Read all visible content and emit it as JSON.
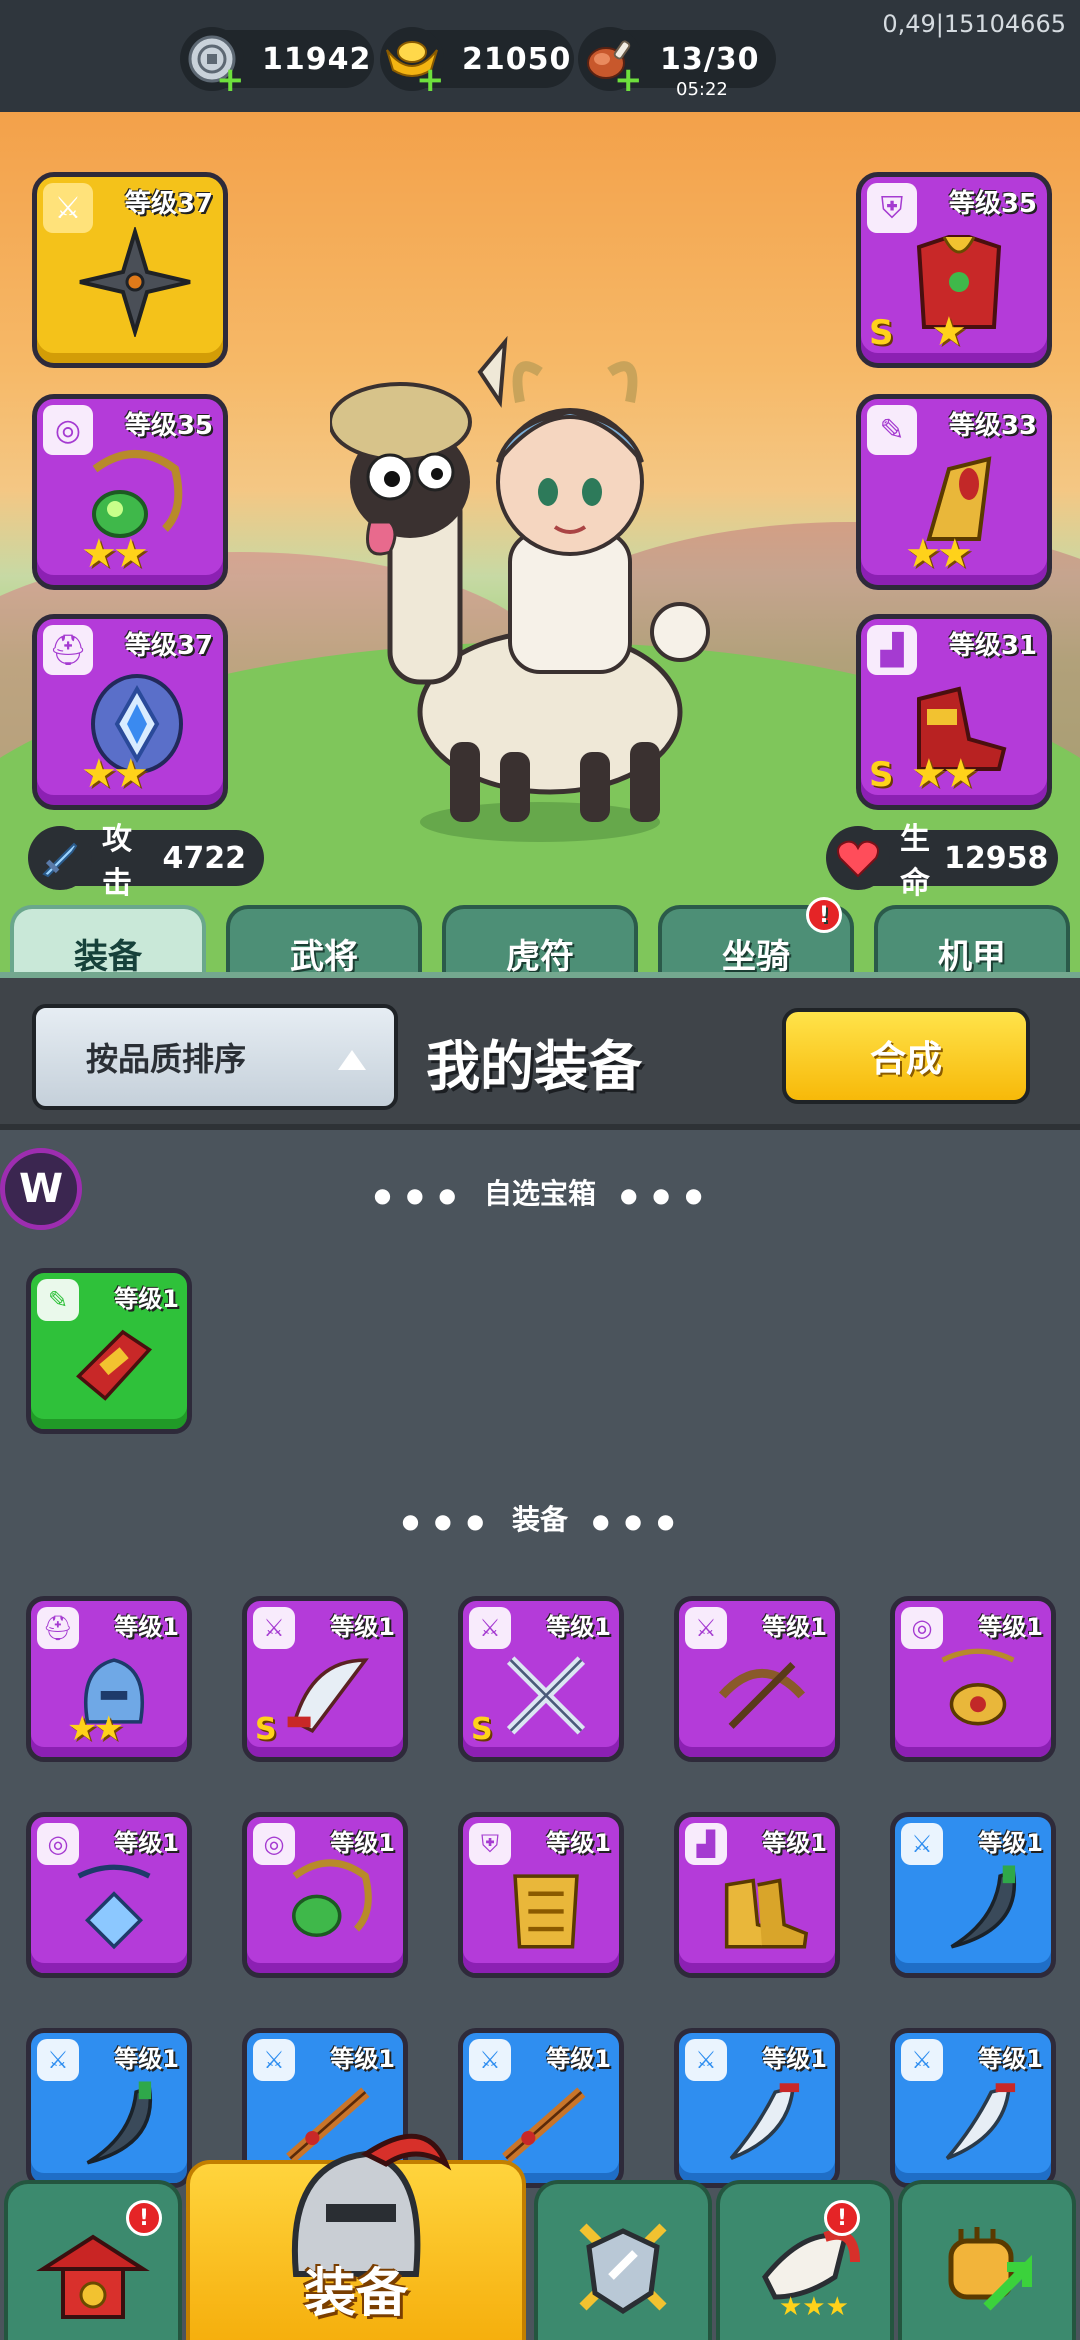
{
  "top_bar": {
    "version": "0,49|15104665",
    "silver": "11942",
    "gold": "21050",
    "stamina": "13/30",
    "stamina_timer": "05:22"
  },
  "hero_slots": [
    {
      "id": "weapon",
      "level": "等级37",
      "rarity": "yellow",
      "type_icon": "sword-icon",
      "item_icon": "shuriken-icon",
      "stars": "",
      "s_rank": ""
    },
    {
      "id": "necklace",
      "level": "等级35",
      "rarity": "purple",
      "type_icon": "medal-icon",
      "item_icon": "jade-necklace-icon",
      "stars": "★★",
      "s_rank": ""
    },
    {
      "id": "helmet",
      "level": "等级37",
      "rarity": "purple",
      "type_icon": "helmet-icon",
      "item_icon": "crest-helmet-icon",
      "stars": "★★",
      "s_rank": ""
    },
    {
      "id": "armor",
      "level": "等级35",
      "rarity": "purple",
      "type_icon": "armor-icon",
      "item_icon": "red-armor-icon",
      "stars": "★",
      "s_rank": "S"
    },
    {
      "id": "bracer",
      "level": "等级33",
      "rarity": "purple",
      "type_icon": "bracer-icon",
      "item_icon": "gold-bracer-icon",
      "stars": "★★",
      "s_rank": ""
    },
    {
      "id": "boots",
      "level": "等级31",
      "rarity": "purple",
      "type_icon": "boot-icon",
      "item_icon": "red-boots-icon",
      "stars": "★★",
      "s_rank": "S"
    }
  ],
  "stats": {
    "attack_label": "攻击",
    "attack_value": "4722",
    "hp_label": "生命",
    "hp_value": "12958"
  },
  "tabs": [
    {
      "label": "装备",
      "active": true
    },
    {
      "label": "武将",
      "active": false
    },
    {
      "label": "虎符",
      "active": false
    },
    {
      "label": "坐骑",
      "active": false,
      "badge": "!"
    },
    {
      "label": "机甲",
      "active": false
    }
  ],
  "toolbar": {
    "sort_label": "按品质排序",
    "title": "我的装备",
    "combine_label": "合成"
  },
  "chest_section": {
    "title": "自选宝箱",
    "items": [
      {
        "level": "等级1",
        "rarity": "green",
        "type_icon": "bracer-icon",
        "item_icon": "red-bracer-icon"
      }
    ]
  },
  "equip_section": {
    "title": "装备",
    "items": [
      {
        "level": "等级1",
        "rarity": "purple",
        "type_icon": "helmet-icon",
        "item_icon": "blue-helmet-icon",
        "stars": "★★",
        "s_rank": ""
      },
      {
        "level": "等级1",
        "rarity": "purple",
        "type_icon": "sword-icon",
        "item_icon": "curved-blade-icon",
        "stars": "",
        "s_rank": "S"
      },
      {
        "level": "等级1",
        "rarity": "purple",
        "type_icon": "sword-icon",
        "item_icon": "crossed-swords-icon",
        "stars": "",
        "s_rank": "S"
      },
      {
        "level": "等级1",
        "rarity": "purple",
        "type_icon": "sword-icon",
        "item_icon": "crossbow-icon",
        "stars": "",
        "s_rank": ""
      },
      {
        "level": "等级1",
        "rarity": "purple",
        "type_icon": "medal-icon",
        "item_icon": "gold-pendant-icon",
        "stars": "",
        "s_rank": ""
      },
      {
        "level": "等级1",
        "rarity": "purple",
        "type_icon": "medal-icon",
        "item_icon": "blue-pendant-icon",
        "stars": "",
        "s_rank": ""
      },
      {
        "level": "等级1",
        "rarity": "purple",
        "type_icon": "medal-icon",
        "item_icon": "jade-necklace-icon",
        "stars": "",
        "s_rank": ""
      },
      {
        "level": "等级1",
        "rarity": "purple",
        "type_icon": "armor-icon",
        "item_icon": "gold-armor-icon",
        "stars": "",
        "s_rank": ""
      },
      {
        "level": "等级1",
        "rarity": "purple",
        "type_icon": "boot-icon",
        "item_icon": "gold-boots-icon",
        "stars": "",
        "s_rank": ""
      },
      {
        "level": "等级1",
        "rarity": "blue",
        "type_icon": "sword-icon",
        "item_icon": "scimitar-icon",
        "stars": "",
        "s_rank": ""
      },
      {
        "level": "等级1",
        "rarity": "blue",
        "type_icon": "sword-icon",
        "item_icon": "scimitar-icon",
        "stars": "",
        "s_rank": ""
      },
      {
        "level": "等级1",
        "rarity": "blue",
        "type_icon": "sword-icon",
        "item_icon": "musket-icon",
        "stars": "",
        "s_rank": ""
      },
      {
        "level": "等级1",
        "rarity": "blue",
        "type_icon": "sword-icon",
        "item_icon": "musket-icon",
        "stars": "",
        "s_rank": ""
      },
      {
        "level": "等级1",
        "rarity": "blue",
        "type_icon": "sword-icon",
        "item_icon": "broadsword-icon",
        "stars": "",
        "s_rank": ""
      },
      {
        "level": "等级1",
        "rarity": "blue",
        "type_icon": "sword-icon",
        "item_icon": "broadsword-icon",
        "stars": "",
        "s_rank": ""
      }
    ]
  },
  "bottom_nav": [
    {
      "id": "shop",
      "icon": "pagoda-icon",
      "badge": "!"
    },
    {
      "id": "equipment",
      "icon": "helmet-icon",
      "label": "装备",
      "active": true
    },
    {
      "id": "battle",
      "icon": "shield-swords-icon"
    },
    {
      "id": "events",
      "icon": "horn-icon",
      "badge": "!"
    },
    {
      "id": "upgrade",
      "icon": "fist-upgrade-icon"
    }
  ],
  "colors": {
    "purple": "#b43bd9",
    "yellow": "#f4c21a",
    "green": "#2fc13a",
    "blue": "#2f8ef0",
    "panel_bg": "#4b545c",
    "tab_green": "#4d8f76"
  }
}
